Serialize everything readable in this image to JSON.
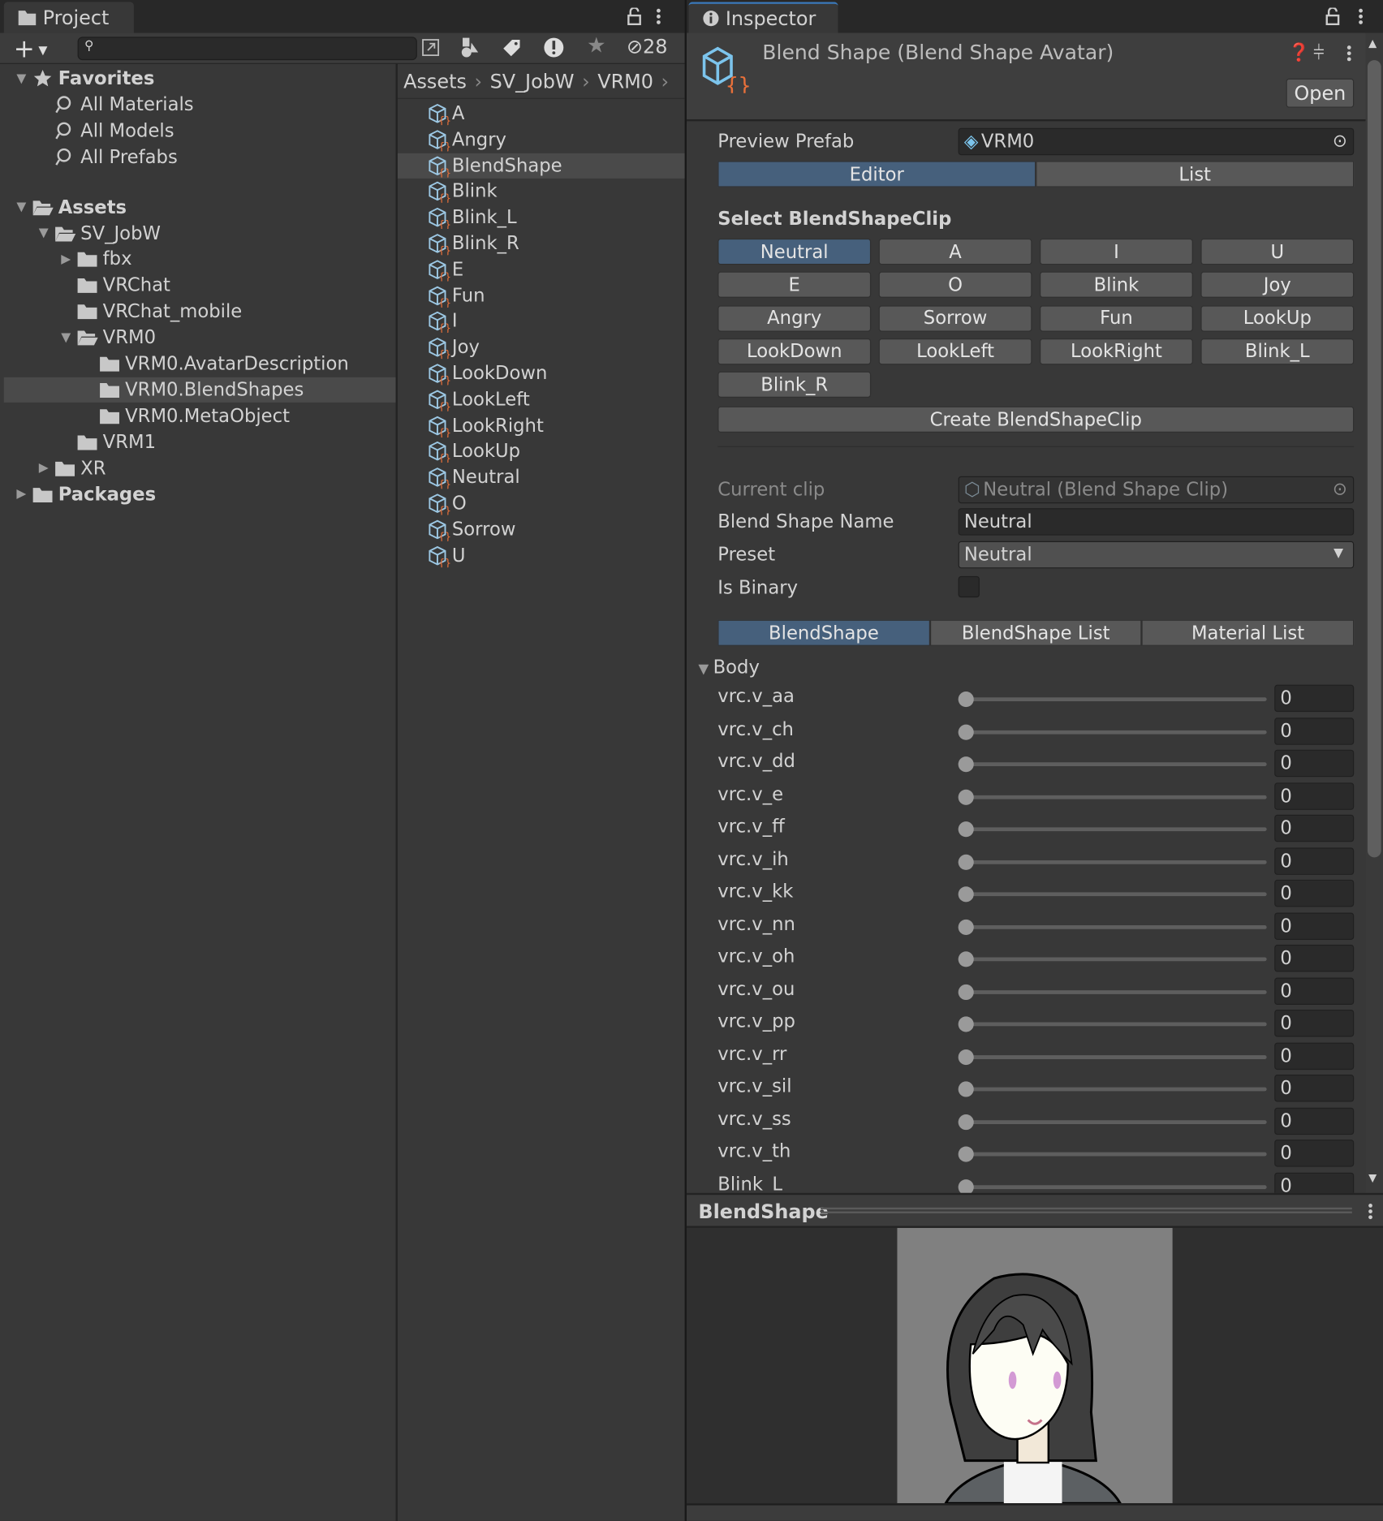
{
  "project": {
    "tab": "Project",
    "hidden_count": "28",
    "search_placeholder": "",
    "tree": [
      {
        "label": "Favorites",
        "indent": 0,
        "kind": "star",
        "arrow": "down",
        "bold": true
      },
      {
        "label": "All Materials",
        "indent": 1,
        "kind": "search"
      },
      {
        "label": "All Models",
        "indent": 1,
        "kind": "search"
      },
      {
        "label": "All Prefabs",
        "indent": 1,
        "kind": "search"
      },
      {
        "label": "",
        "indent": 0,
        "kind": "gap"
      },
      {
        "label": "Assets",
        "indent": 0,
        "kind": "folder-open",
        "arrow": "down",
        "bold": true
      },
      {
        "label": "SV_JobW",
        "indent": 1,
        "kind": "folder-open",
        "arrow": "down"
      },
      {
        "label": "fbx",
        "indent": 2,
        "kind": "folder",
        "arrow": "right"
      },
      {
        "label": "VRChat",
        "indent": 2,
        "kind": "folder"
      },
      {
        "label": "VRChat_mobile",
        "indent": 2,
        "kind": "folder"
      },
      {
        "label": "VRM0",
        "indent": 2,
        "kind": "folder-open",
        "arrow": "down"
      },
      {
        "label": "VRM0.AvatarDescription",
        "indent": 3,
        "kind": "folder"
      },
      {
        "label": "VRM0.BlendShapes",
        "indent": 3,
        "kind": "folder",
        "selected": true
      },
      {
        "label": "VRM0.MetaObject",
        "indent": 3,
        "kind": "folder"
      },
      {
        "label": "VRM1",
        "indent": 2,
        "kind": "folder"
      },
      {
        "label": "XR",
        "indent": 1,
        "kind": "folder",
        "arrow": "right"
      },
      {
        "label": "Packages",
        "indent": 0,
        "kind": "folder",
        "arrow": "right",
        "bold": true
      }
    ],
    "breadcrumb": [
      "Assets",
      "SV_JobW",
      "VRM0"
    ],
    "assets": [
      "A",
      "Angry",
      "BlendShape",
      "Blink",
      "Blink_L",
      "Blink_R",
      "E",
      "Fun",
      "I",
      "Joy",
      "LookDown",
      "LookLeft",
      "LookRight",
      "LookUp",
      "Neutral",
      "O",
      "Sorrow",
      "U"
    ],
    "selected_asset": "BlendShape"
  },
  "inspector": {
    "tab": "Inspector",
    "title": "Blend Shape (Blend Shape Avatar)",
    "open_label": "Open",
    "preview_prefab_label": "Preview Prefab",
    "preview_prefab_value": "VRM0",
    "mode_tabs": [
      "Editor",
      "List"
    ],
    "mode_active": 0,
    "select_heading": "Select BlendShapeClip",
    "clips": [
      "Neutral",
      "A",
      "I",
      "U",
      "E",
      "O",
      "Blink",
      "Joy",
      "Angry",
      "Sorrow",
      "Fun",
      "LookUp",
      "LookDown",
      "LookLeft",
      "LookRight",
      "Blink_L",
      "Blink_R"
    ],
    "clip_active": "Neutral",
    "create_label": "Create BlendShapeClip",
    "current_clip_label": "Current clip",
    "current_clip_value": "Neutral (Blend Shape Clip)",
    "name_label": "Blend Shape Name",
    "name_value": "Neutral",
    "preset_label": "Preset",
    "preset_value": "Neutral",
    "binary_label": "Is Binary",
    "is_binary": false,
    "sub_tabs": [
      "BlendShape",
      "BlendShape List",
      "Material List"
    ],
    "sub_active": 0,
    "group": "Body",
    "shapes": [
      {
        "name": "vrc.v_aa",
        "value": 0
      },
      {
        "name": "vrc.v_ch",
        "value": 0
      },
      {
        "name": "vrc.v_dd",
        "value": 0
      },
      {
        "name": "vrc.v_e",
        "value": 0
      },
      {
        "name": "vrc.v_ff",
        "value": 0
      },
      {
        "name": "vrc.v_ih",
        "value": 0
      },
      {
        "name": "vrc.v_kk",
        "value": 0
      },
      {
        "name": "vrc.v_nn",
        "value": 0
      },
      {
        "name": "vrc.v_oh",
        "value": 0
      },
      {
        "name": "vrc.v_ou",
        "value": 0
      },
      {
        "name": "vrc.v_pp",
        "value": 0
      },
      {
        "name": "vrc.v_rr",
        "value": 0
      },
      {
        "name": "vrc.v_sil",
        "value": 0
      },
      {
        "name": "vrc.v_ss",
        "value": 0
      },
      {
        "name": "vrc.v_th",
        "value": 0
      },
      {
        "name": "Blink_L",
        "value": 0
      }
    ],
    "preview_title": "BlendShape"
  },
  "colors": {
    "accent": "#46607c",
    "panel": "#383838",
    "icon_blue": "#7cc4ec",
    "icon_orange": "#e8703a"
  }
}
